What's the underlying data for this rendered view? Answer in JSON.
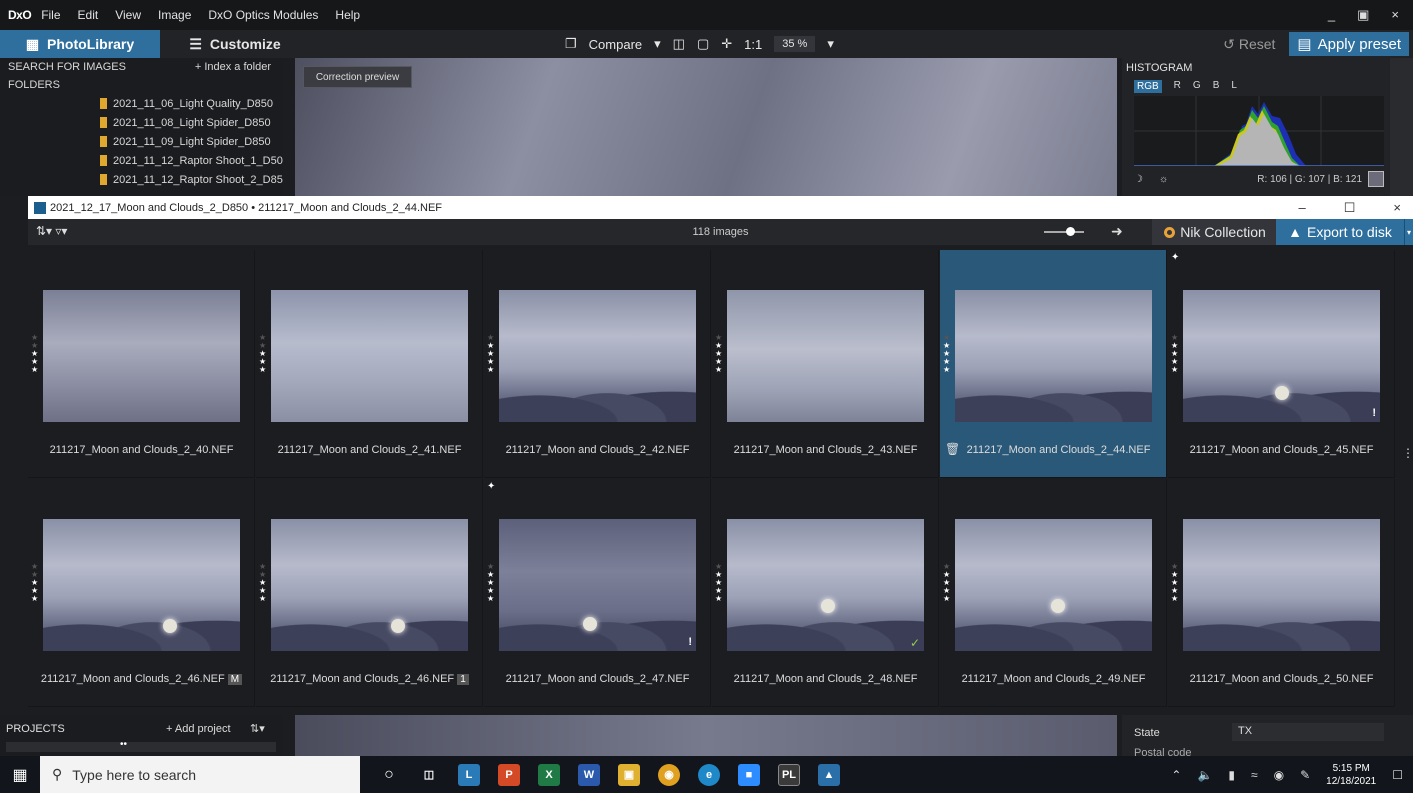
{
  "menubar": {
    "logo": "DxO",
    "items": [
      "File",
      "Edit",
      "View",
      "Image",
      "DxO Optics Modules",
      "Help"
    ],
    "window_buttons": [
      "_",
      "×"
    ]
  },
  "toolbar": {
    "photolibrary": "PhotoLibrary",
    "customize": "Customize",
    "compare": "Compare",
    "one_to_one": "1:1",
    "zoom": "35 %",
    "reset": "Reset",
    "apply_preset": "Apply preset"
  },
  "left_panel": {
    "search": "SEARCH FOR IMAGES",
    "index": "+ Index a folder",
    "folders": "FOLDERS",
    "folder_items": [
      "2021_11_06_Light Quality_D850",
      "2021_11_08_Light Spider_D850",
      "2021_11_09_Light Spider_D850",
      "2021_11_12_Raptor Shoot_1_D50",
      "2021_11_12_Raptor Shoot_2_D85"
    ]
  },
  "preview": {
    "correction_preview": "Correction preview"
  },
  "histogram": {
    "title": "HISTOGRAM",
    "channels": [
      "RGB",
      "R",
      "G",
      "B",
      "L"
    ],
    "values": "R: 106 | G: 107 | B: 121"
  },
  "filmstrip": {
    "title": "2021_12_17_Moon and Clouds_2_D850 • 211217_Moon and Clouds_2_44.NEF",
    "window_buttons": [
      "–",
      "☐",
      "×"
    ],
    "count": "118 images",
    "nik": "Nik Collection",
    "export": "Export to disk",
    "images": [
      {
        "name": "211217_Moon and Clouds_2_40.NEF"
      },
      {
        "name": "211217_Moon and Clouds_2_41.NEF"
      },
      {
        "name": "211217_Moon and Clouds_2_42.NEF"
      },
      {
        "name": "211217_Moon and Clouds_2_43.NEF"
      },
      {
        "name": "211217_Moon and Clouds_2_44.NEF"
      },
      {
        "name": "211217_Moon and Clouds_2_45.NEF"
      },
      {
        "name": "211217_Moon and Clouds_2_46.NEF",
        "badge": "M"
      },
      {
        "name": "211217_Moon and Clouds_2_46.NEF",
        "badge": "1"
      },
      {
        "name": "211217_Moon and Clouds_2_47.NEF"
      },
      {
        "name": "211217_Moon and Clouds_2_48.NEF"
      },
      {
        "name": "211217_Moon and Clouds_2_49.NEF"
      },
      {
        "name": "211217_Moon and Clouds_2_50.NEF"
      }
    ]
  },
  "projects": {
    "title": "PROJECTS",
    "add": "+ Add project"
  },
  "metadata": {
    "state_label": "State",
    "state_value": "TX",
    "postal_label": "Postal code"
  },
  "taskbar": {
    "search_placeholder": "Type here to search",
    "time": "5:15 PM",
    "date": "12/18/2021"
  }
}
